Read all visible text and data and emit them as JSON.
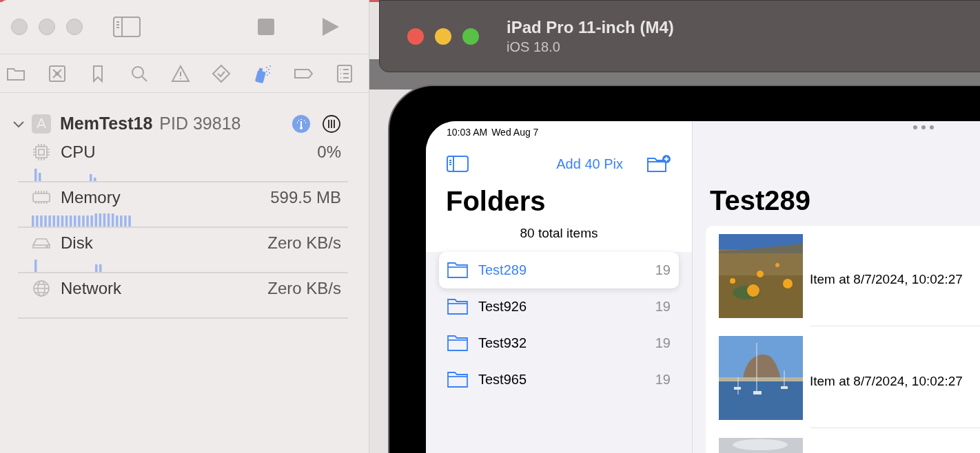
{
  "xcode": {
    "navigator_tabs": [
      {
        "selected": false
      },
      {
        "selected": false
      },
      {
        "selected": false
      },
      {
        "selected": false
      },
      {
        "selected": false
      },
      {
        "selected": false
      },
      {
        "selected": true
      },
      {
        "selected": false
      },
      {
        "selected": false
      }
    ],
    "process": {
      "name": "MemTest18",
      "pid": "PID 39818",
      "expanded": true
    },
    "metrics": [
      {
        "name": "CPU",
        "value": "0%"
      },
      {
        "name": "Memory",
        "value": "599.5 MB"
      },
      {
        "name": "Disk",
        "value": "Zero KB/s"
      },
      {
        "name": "Network",
        "value": "Zero KB/s"
      }
    ]
  },
  "simulator": {
    "title": "iPad Pro 11-inch (M4)",
    "subtitle": "iOS 18.0"
  },
  "ipad": {
    "status_bar": {
      "time": "10:03 AM",
      "date": "Wed Aug 7"
    },
    "sidebar": {
      "action": "Add 40 Pix",
      "title": "Folders",
      "subtitle": "80 total items",
      "folders": [
        {
          "name": "Test289",
          "count": "19",
          "selected": true
        },
        {
          "name": "Test926",
          "count": "19",
          "selected": false
        },
        {
          "name": "Test932",
          "count": "19",
          "selected": false
        },
        {
          "name": "Test965",
          "count": "19",
          "selected": false
        }
      ]
    },
    "detail": {
      "title": "Test289",
      "items": [
        {
          "kind": "picture",
          "label": "Item at 8/7/2024, 10:02:27"
        },
        {
          "kind": "picture",
          "label": "Item at 8/7/2024, 10:02:27"
        },
        {
          "kind": "picture"
        }
      ]
    }
  }
}
